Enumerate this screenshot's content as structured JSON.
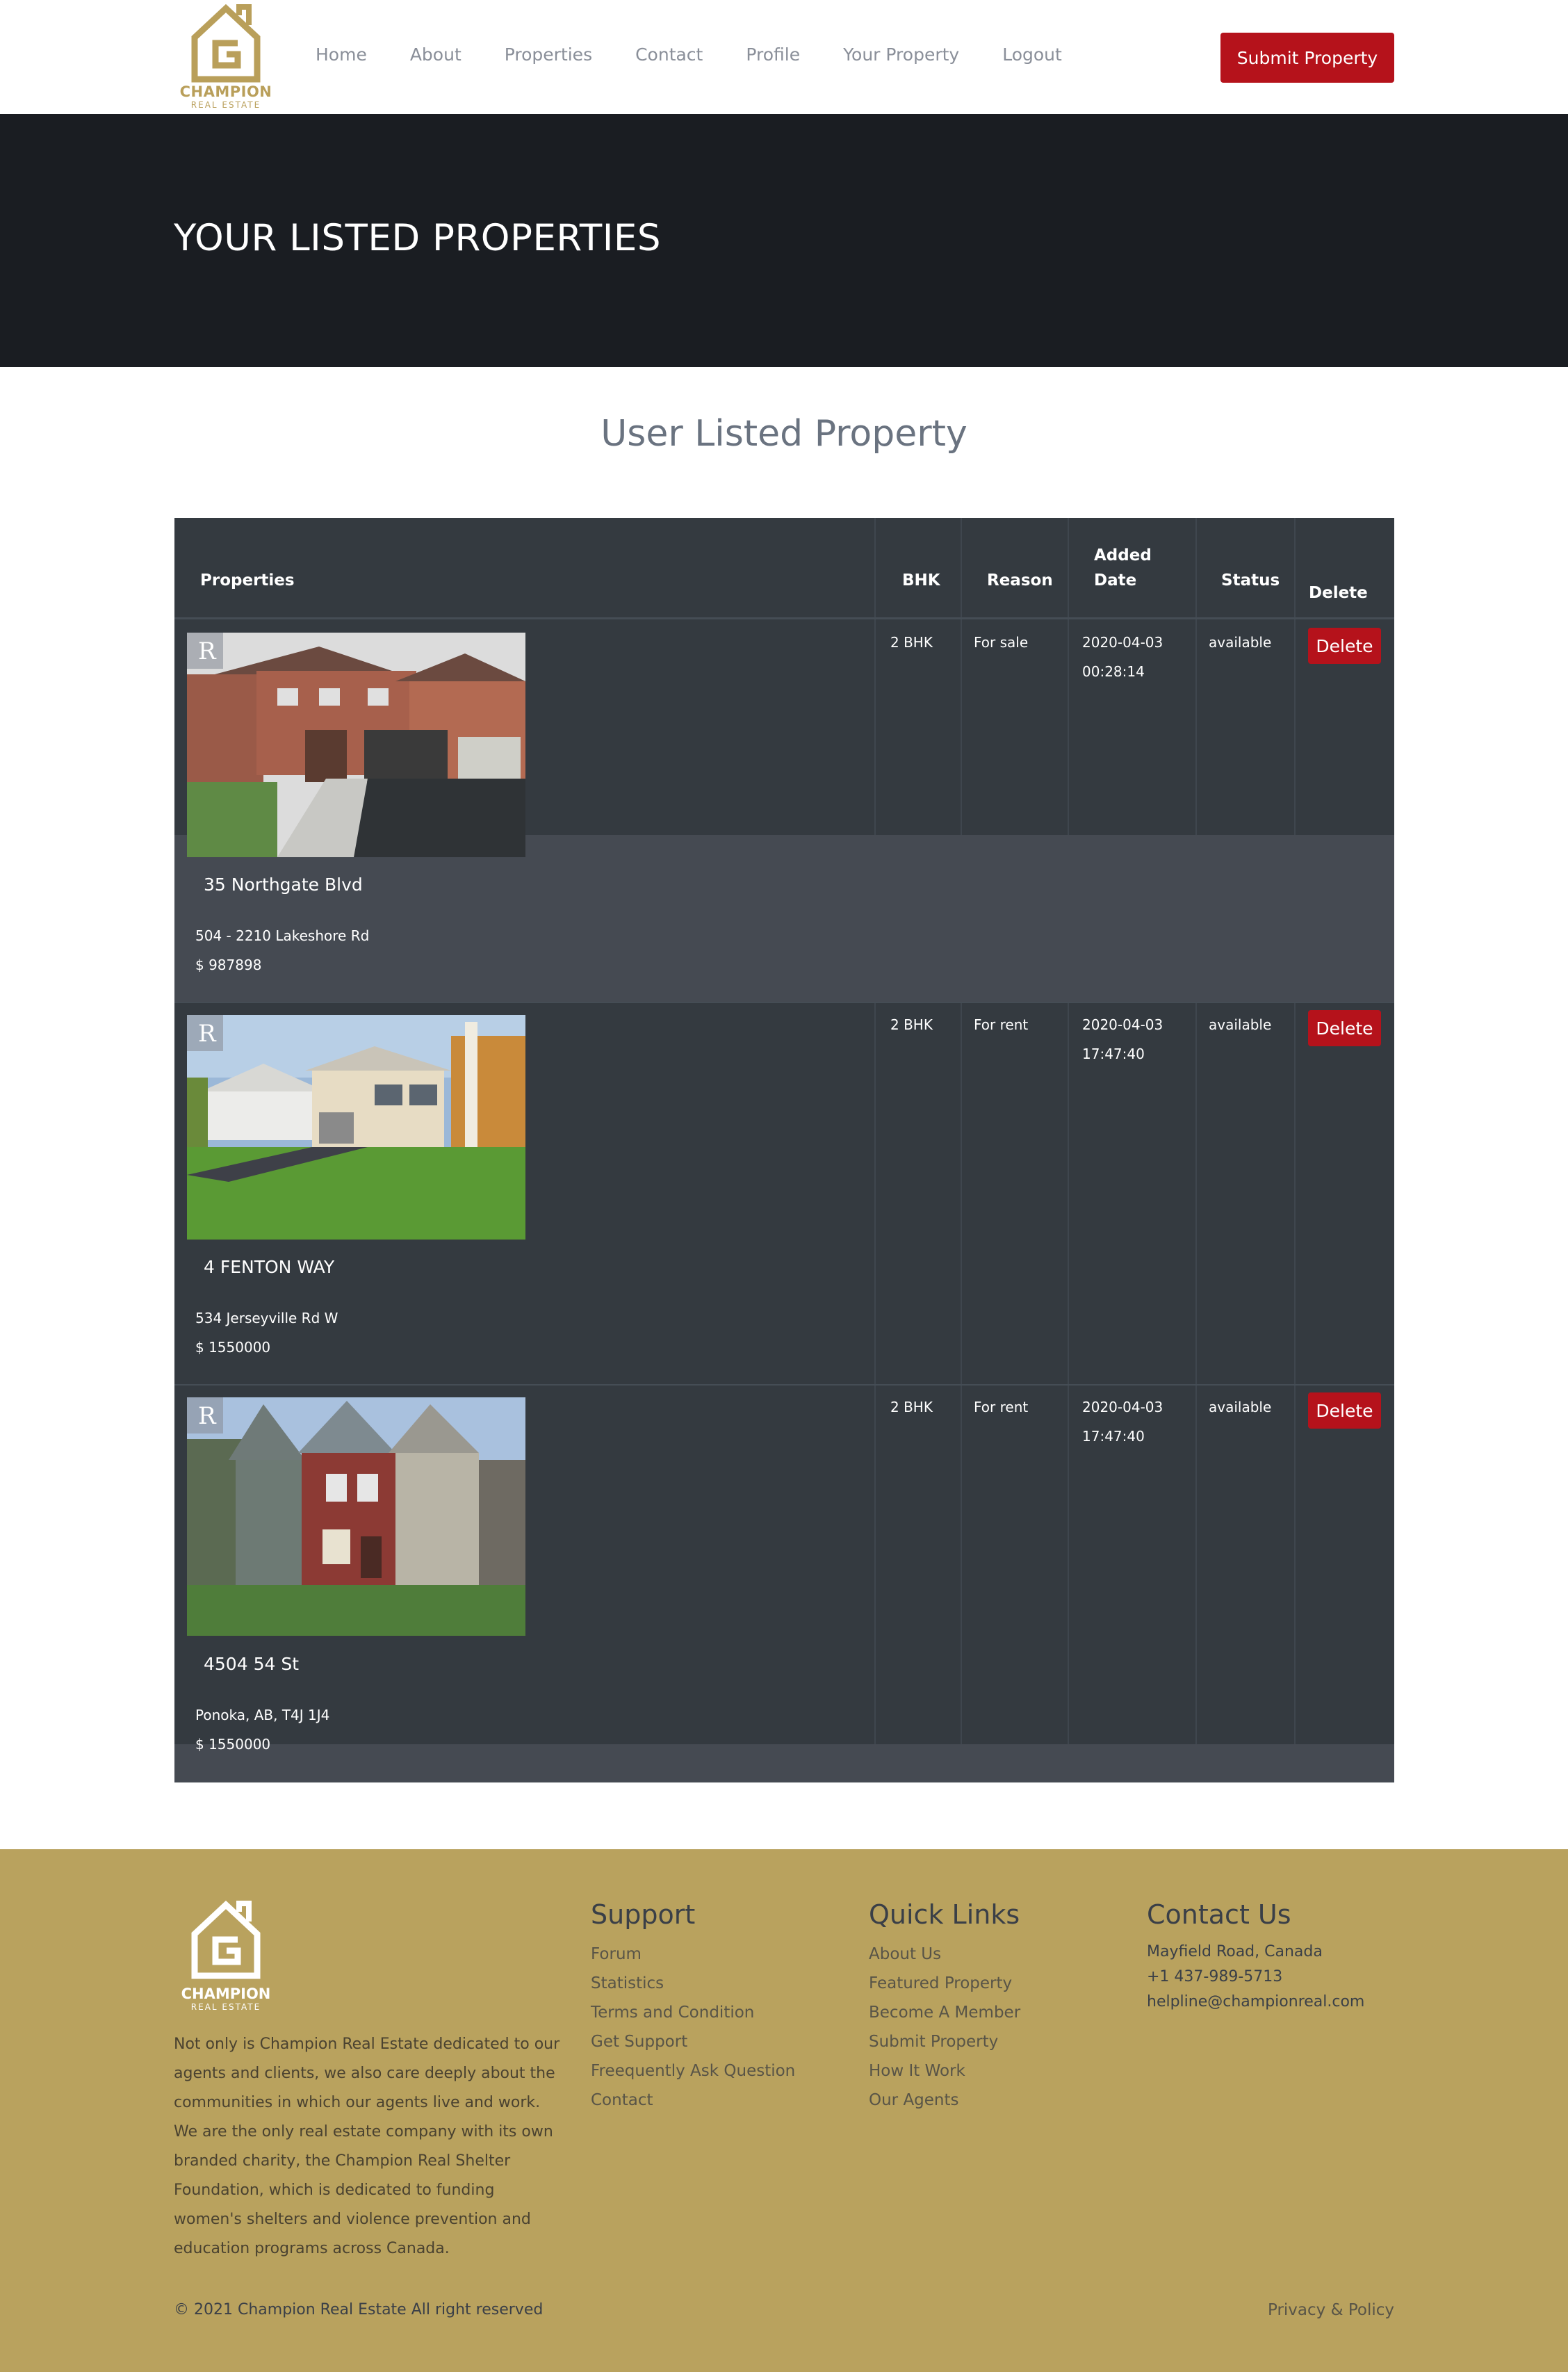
{
  "brand": {
    "name": "CHAMPION",
    "sub": "REAL ESTATE"
  },
  "nav": {
    "items": [
      "Home",
      "About",
      "Properties",
      "Contact",
      "Profile",
      "Your Property",
      "Logout"
    ],
    "submit_label": "Submit Property"
  },
  "hero": {
    "title": "YOUR LISTED PROPERTIES"
  },
  "section": {
    "title": "User Listed Property"
  },
  "table": {
    "headers": {
      "properties": "Properties",
      "bhk": "BHK",
      "reason": "Reason",
      "added_line1": "Added",
      "added_line2": "Date",
      "status": "Status",
      "delete": "Delete"
    },
    "rows": [
      {
        "name": "35 Northgate Blvd",
        "address": "504 - 2210 Lakeshore Rd",
        "price": "$ 987898",
        "bhk": "2 BHK",
        "reason": "For sale",
        "date": "2020-04-03",
        "time": "00:28:14",
        "status": "available",
        "delete_label": "Delete"
      },
      {
        "name": "4 FENTON WAY",
        "address": "534 Jerseyville Rd W",
        "price": "$ 1550000",
        "bhk": "2 BHK",
        "reason": "For rent",
        "date": "2020-04-03",
        "time": "17:47:40",
        "status": "available",
        "delete_label": "Delete"
      },
      {
        "name": "4504 54 St",
        "address": "Ponoka, AB, T4J 1J4",
        "price": "$ 1550000",
        "bhk": "2 BHK",
        "reason": "For rent",
        "date": "2020-04-03",
        "time": "17:47:40",
        "status": "available",
        "delete_label": "Delete"
      }
    ]
  },
  "footer": {
    "about": "Not only is Champion Real Estate dedicated to our agents and clients, we also care deeply about the communities in which our agents live and work. We are the only real estate company with its own branded charity, the Champion Real Shelter Foundation, which is dedicated to funding women's shelters and violence prevention and education programs across Canada.",
    "support": {
      "title": "Support",
      "links": [
        "Forum",
        "Statistics",
        "Terms and Condition",
        "Get Support",
        "Freequently Ask Question",
        "Contact"
      ]
    },
    "quick": {
      "title": "Quick Links",
      "links": [
        "About Us",
        "Featured Property",
        "Become A Member",
        "Submit Property",
        "How It Work",
        "Our Agents"
      ]
    },
    "contact": {
      "title": "Contact Us",
      "address": "Mayfield Road, Canada",
      "phone": "+1 437-989-5713",
      "email": "helpline@championreal.com"
    },
    "copyright": "© 2021 Champion Real Estate All right reserved",
    "privacy": "Privacy & Policy"
  },
  "colors": {
    "accent": "#b5121b",
    "gold": "#b9a25e",
    "dark": "#1a1d22",
    "table": "#343a40"
  }
}
